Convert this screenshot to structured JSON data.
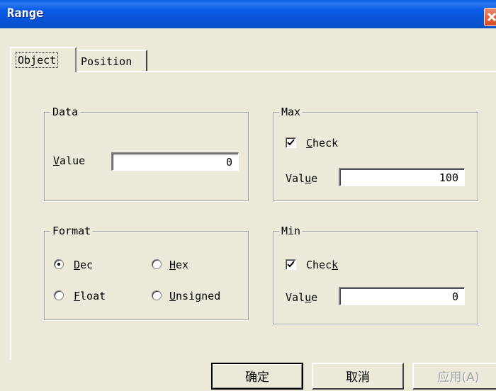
{
  "window": {
    "title": "Range"
  },
  "tabs": [
    {
      "label": "Object",
      "active": true
    },
    {
      "label": "Position",
      "active": false
    }
  ],
  "data_group": {
    "legend": "Data",
    "value_label": "Value",
    "value_mnemonic": "V",
    "value_rest": "alue",
    "value": "0"
  },
  "max_group": {
    "legend": "Max",
    "check_label_mnemonic": "C",
    "check_label_rest": "heck",
    "checked": true,
    "value_pre": "Val",
    "value_mnemonic": "u",
    "value_post": "e",
    "value": "100"
  },
  "format_group": {
    "legend": "Format",
    "options": [
      {
        "mnemonic": "D",
        "rest": "ec",
        "selected": true
      },
      {
        "mnemonic": "H",
        "rest": "ex",
        "selected": false
      },
      {
        "mnemonic": "F",
        "rest": "loat",
        "selected": false
      },
      {
        "mnemonic": "U",
        "rest": "nsigned",
        "selected": false
      }
    ]
  },
  "min_group": {
    "legend": "Min",
    "check_pre": "Chec",
    "check_mnemonic": "k",
    "checked": true,
    "value_pre": "Val",
    "value_mnemonic": "u",
    "value_post": "e",
    "value": "0"
  },
  "buttons": {
    "ok": "确定",
    "cancel": "取消",
    "apply": "应用(A)"
  }
}
